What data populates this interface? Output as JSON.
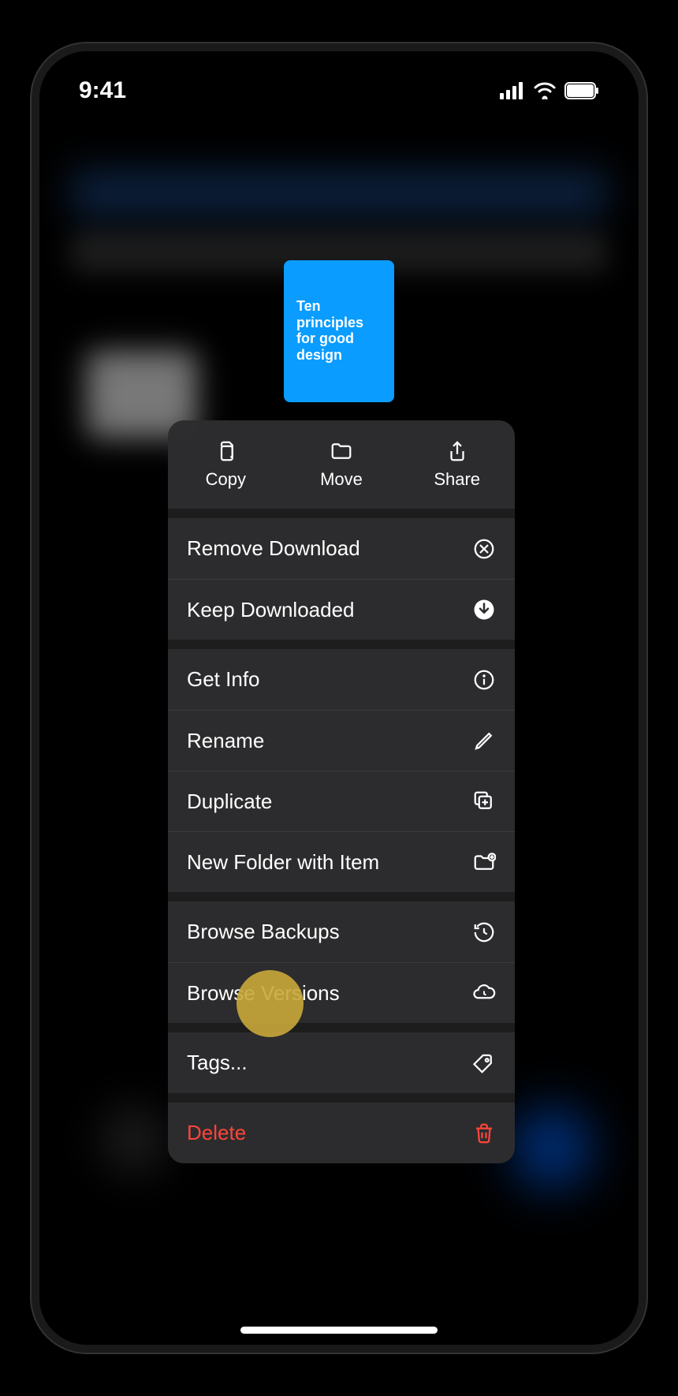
{
  "status_bar": {
    "time": "9:41"
  },
  "file_preview": {
    "title": "Ten principles for good design"
  },
  "context_menu": {
    "top_actions": {
      "copy": "Copy",
      "move": "Move",
      "share": "Share"
    },
    "items": {
      "remove_download": "Remove Download",
      "keep_downloaded": "Keep Downloaded",
      "get_info": "Get Info",
      "rename": "Rename",
      "duplicate": "Duplicate",
      "new_folder": "New Folder with Item",
      "browse_backups": "Browse Backups",
      "browse_versions": "Browse Versions",
      "tags": "Tags...",
      "delete": "Delete"
    }
  }
}
